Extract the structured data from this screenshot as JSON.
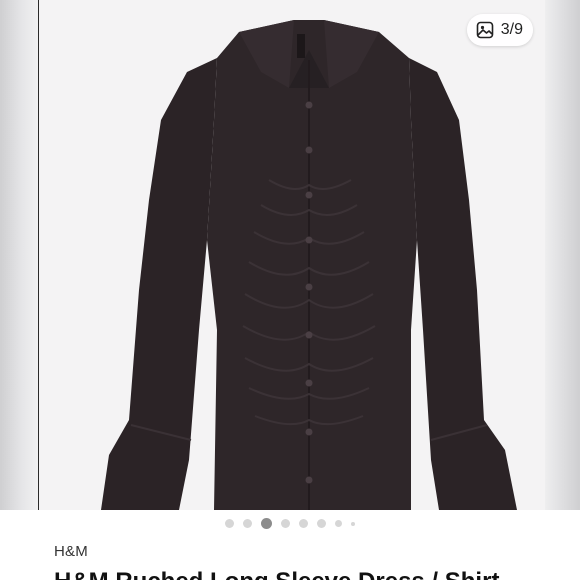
{
  "gallery": {
    "counter_text": "3/9",
    "counter_icon": "image-gallery-icon",
    "total_images": 9,
    "active_index": 3
  },
  "listing": {
    "brand": "H&M",
    "title": "H&M Ruched Long Sleeve Dress / Shirt"
  },
  "colors": {
    "garment": "#2e2629",
    "background": "#f4f3f4"
  }
}
